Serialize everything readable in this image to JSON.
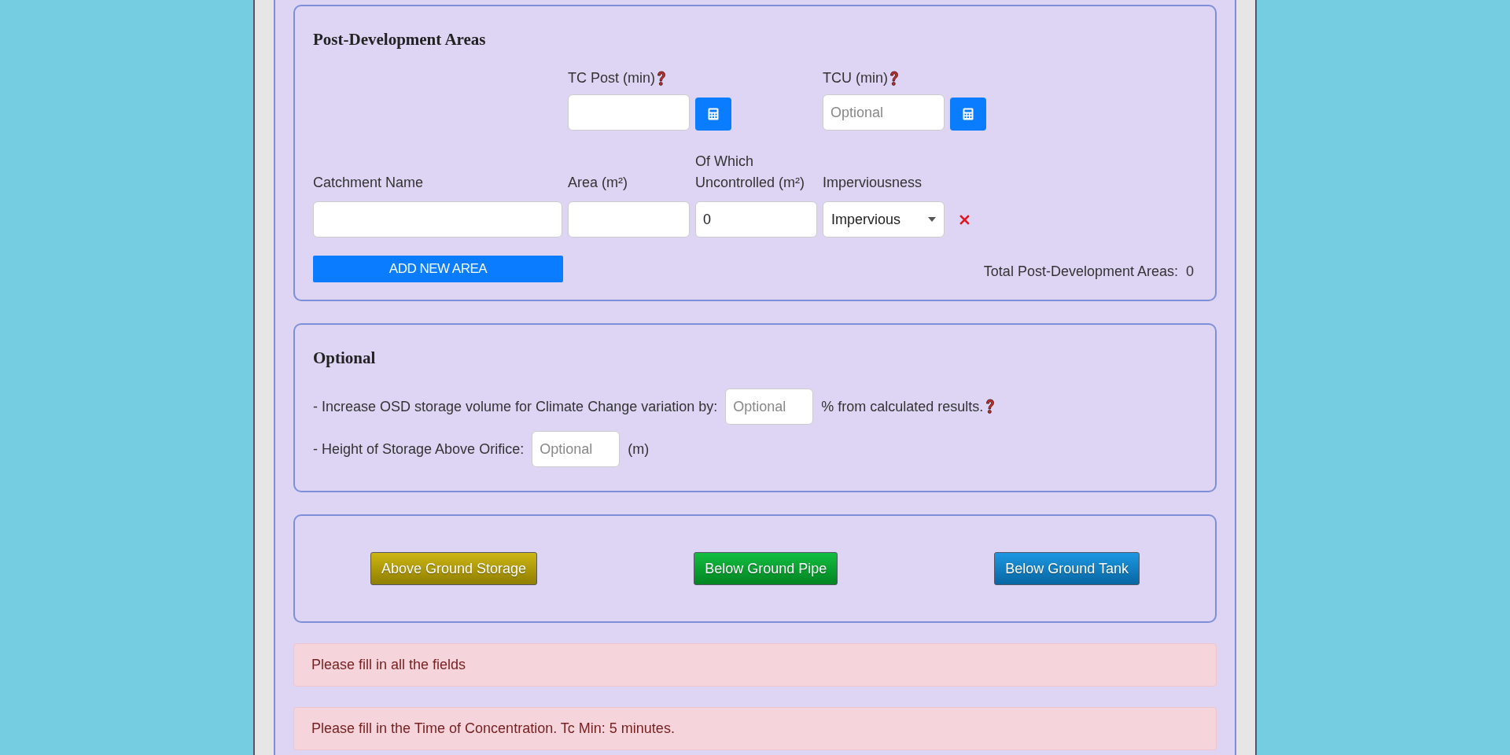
{
  "post_development": {
    "title": "Post-Development Areas",
    "timing_fields": [
      {
        "label": "TC Post (min)",
        "help": true
      },
      {
        "label": "TCU (min)",
        "help": true,
        "placeholder": "Optional"
      }
    ],
    "columns": [
      "Catchment Name",
      "Area (m²)",
      "Of Which Uncontrolled (m²)",
      "Imperviousness"
    ],
    "rows": [
      {
        "uncontrolled": "0",
        "imperviousness": "Impervious"
      }
    ],
    "add_button": "ADD NEW AREA",
    "total_label": "Total Post-Development Areas:",
    "total_value": "0"
  },
  "optional": {
    "title": "Optional",
    "lines": [
      {
        "prefix": "- Increase OSD storage volume for Climate Change variation by:",
        "placeholder": "Optional",
        "suffix": "% from calculated results.",
        "help": true
      },
      {
        "prefix": "- Height of Storage Above Orifice:",
        "placeholder": "Optional",
        "suffix": "(m)",
        "help": false
      }
    ]
  },
  "storage_buttons": [
    {
      "label": "Above Ground Storage",
      "color": "#c8b000"
    },
    {
      "label": "Below Ground Pipe",
      "color": "#00b830"
    },
    {
      "label": "Below Ground Tank",
      "color": "#0a8ee0"
    }
  ],
  "alerts": [
    "Please fill in all the fields",
    "Please fill in the Time of Concentration. Tc Min: 5 minutes."
  ]
}
